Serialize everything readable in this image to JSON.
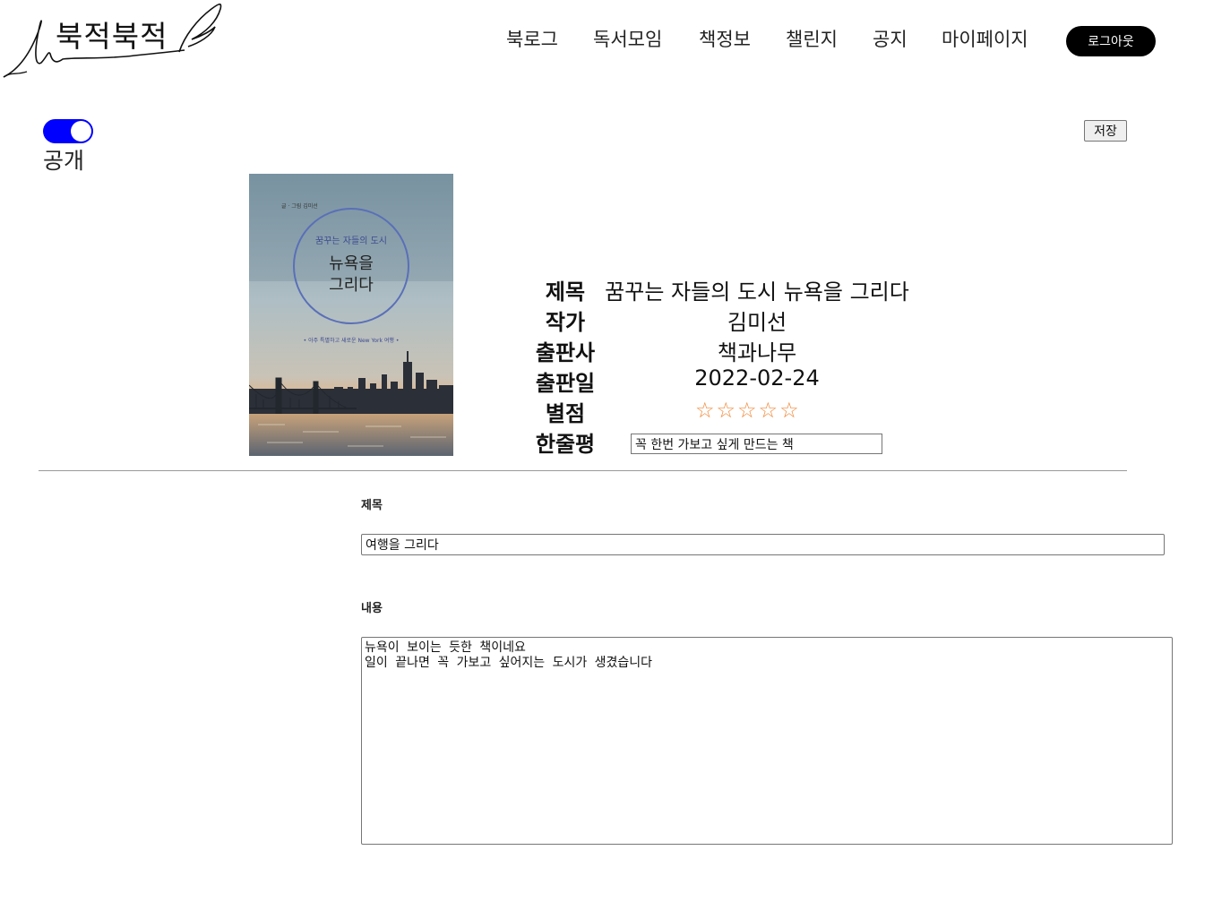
{
  "header": {
    "logo_text": "북적북적",
    "nav": [
      "북로그",
      "독서모임",
      "책정보",
      "챌린지",
      "공지",
      "마이페이지"
    ],
    "logout_label": "로그아웃"
  },
  "visibility": {
    "toggle_on": true,
    "label": "공개"
  },
  "save_label": "저장",
  "cover": {
    "author_small": "글 · 그림 김미선",
    "subtitle": "꿈꾸는 자들의 도시",
    "title_line1": "뉴욕을",
    "title_line2": "그리다",
    "tagline": "• 아주 특별하고 새로운 New York 여행 •"
  },
  "book": {
    "labels": {
      "title": "제목",
      "author": "작가",
      "publisher": "출판사",
      "date": "출판일",
      "rating": "별점",
      "review": "한줄평"
    },
    "title": "꿈꾸는 자들의 도시 뉴욕을 그리다",
    "author": "김미선",
    "publisher": "책과나무",
    "date": "2022-02-24",
    "rating": 0,
    "rating_max": 5,
    "review": "꼭 한번 가보고 싶게 만드는 책",
    "star_color": "#f08a3c"
  },
  "post": {
    "title_label": "제목",
    "title_value": "여행을 그리다",
    "content_label": "내용",
    "content_value": "뉴욕이 보이는 듯한 책이네요\n일이 끝나면 꼭 가보고 싶어지는 도시가 생겼습니다"
  },
  "colors": {
    "toggle": "#0000ff",
    "logout_bg": "#000000"
  }
}
